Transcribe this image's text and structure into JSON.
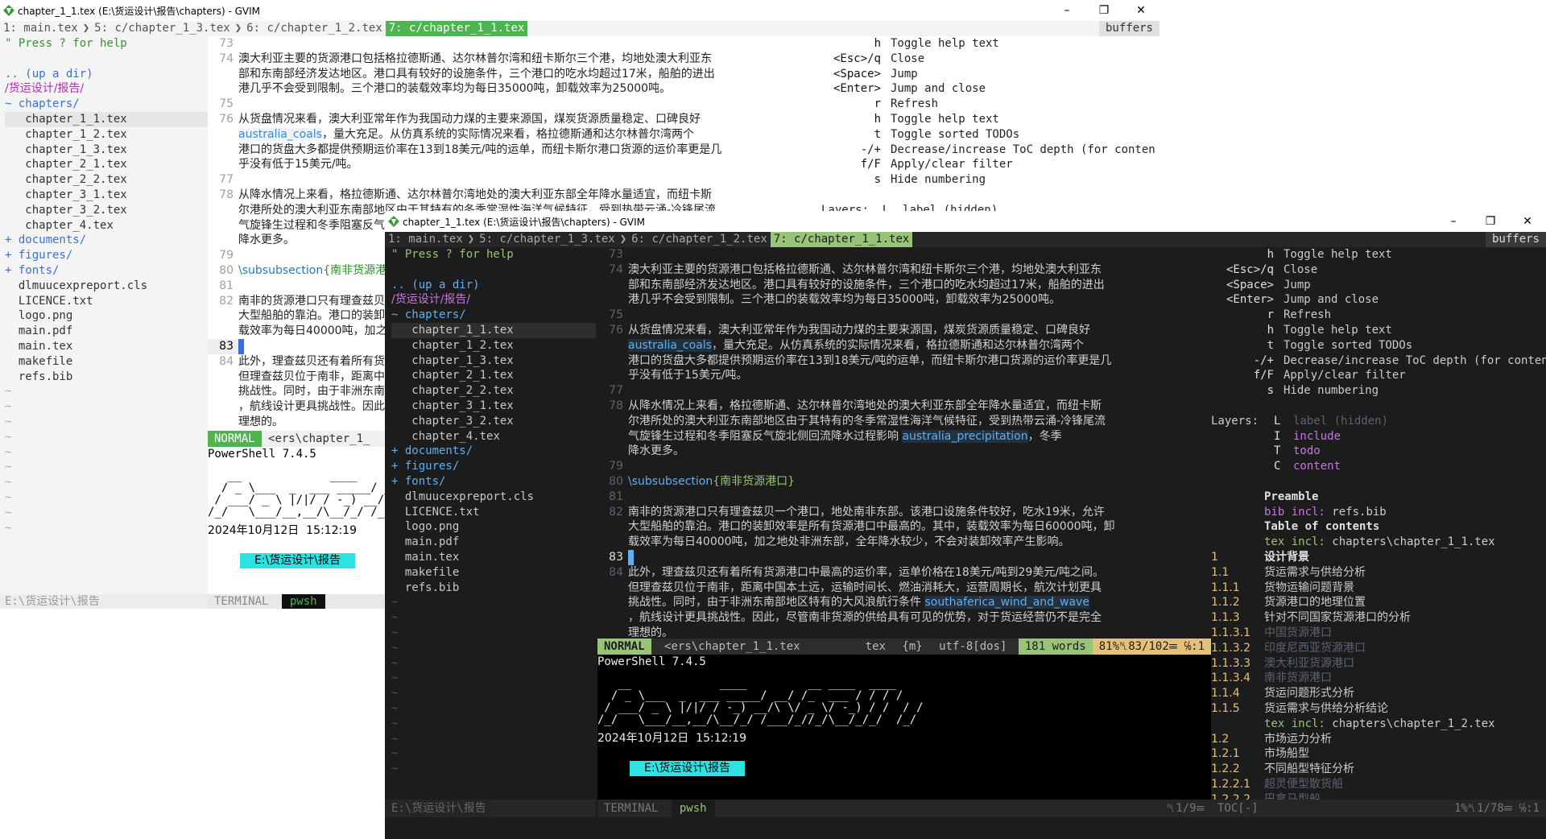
{
  "windows": {
    "back": {
      "title": "chapter_1_1.tex (E:\\货运设计\\报告\\chapters) - GVIM",
      "tabs": [
        "1: main.tex",
        "5: c/chapter_1_3.tex",
        "6: c/chapter_1_2.tex",
        "7: c/chapter_1_1.tex"
      ],
      "buffers_label": "buffers",
      "statusline": {
        "mode": "NORMAL",
        "file": "<ers\\chapter_1_"
      },
      "tree_status": "E:\\货运设计\\报告",
      "terminal_status": {
        "label": "TERMINAL",
        "shell": "pwsh"
      },
      "help_layers": "Layers:  L  label (hidden)"
    },
    "front": {
      "title": "chapter_1_1.tex (E:\\货运设计\\报告\\chapters) - GVIM",
      "tabs": [
        "1: main.tex",
        "5: c/chapter_1_3.tex",
        "6: c/chapter_1_2.tex",
        "7: c/chapter_1_1.tex"
      ],
      "buffers_label": "buffers",
      "statusline": {
        "mode": "NORMAL",
        "file": "<ers\\chapter_1_1.tex",
        "filetype": "tex",
        "extra": "{m}",
        "encoding": "utf-8[dos]",
        "words": "181 words",
        "position": "81%␤83/102☰ ℅:1"
      },
      "tree_status": "E:\\货运设计\\报告",
      "tree_status_right": "␤1/9☰",
      "terminal_status": {
        "label": "TERMINAL",
        "shell": "pwsh"
      },
      "toc_status": "TOC[-]",
      "toc_status_right": "1%␤1/78☰ ℅:1"
    }
  },
  "tree": {
    "help": "\" Press ? for help",
    "up": ".. (up a dir)",
    "path": "/货运设计/报告/",
    "chapters_dir": "~ chapters/",
    "chapter_files": [
      "chapter_1_1.tex",
      "chapter_1_2.tex",
      "chapter_1_3.tex",
      "chapter_2_1.tex",
      "chapter_2_2.tex",
      "chapter_3_1.tex",
      "chapter_3_2.tex",
      "chapter_4.tex"
    ],
    "collapsed_dirs": [
      "+ documents/",
      "+ figures/",
      "+ fonts/"
    ],
    "files": [
      "dlmuucexpreport.cls",
      "LICENCE.txt",
      "logo.png",
      "main.pdf",
      "main.tex",
      "makefile",
      "refs.bib"
    ]
  },
  "editor": {
    "lines": [
      {
        "n": "73",
        "t": ""
      },
      {
        "n": "74",
        "t": "澳大利亚主要的货源港口包括格拉德斯通、达尔林普尔湾和纽卡斯尔三个港，均地处澳大利亚东"
      },
      {
        "n": "",
        "t": "部和东南部经济发达地区。港口具有较好的设施条件，三个港口的吃水均超过17米，船舶的进出"
      },
      {
        "n": "",
        "t": "港几乎不会受到限制。三个港口的装载效率均为每日35000吨，卸载效率为25000吨。"
      },
      {
        "n": "75",
        "t": ""
      },
      {
        "n": "76",
        "t": "从货盘情况来看，澳大利亚常年作为我国动力煤的主要来源国，煤炭货源质量稳定、口碑良好"
      },
      {
        "n": "",
        "t": "",
        "ref": "australia_coals",
        "after": "，量大充足。从仿真系统的实际情况来看，格拉德斯通和达尔林普尔湾两个"
      },
      {
        "n": "",
        "t": "港口的货盘大多都提供预期运价率在13到18美元/吨的运单，而纽卡斯尔港口货源的运价率更是几"
      },
      {
        "n": "",
        "t": "乎没有低于15美元/吨。"
      },
      {
        "n": "77",
        "t": ""
      },
      {
        "n": "78",
        "t": "从降水情况上来看，格拉德斯通、达尔林普尔湾地处的澳大利亚东部全年降水量适宜，而纽卡斯"
      },
      {
        "n": "",
        "t": "尔港所处的澳大利亚东南部地区由于其特有的冬季常湿性海洋气候特征，受到热带云涌-冷锋尾流"
      },
      {
        "n": "",
        "t": "气旋锋生过程和冬季阻塞反气旋北侧回流降水过程影响 ",
        "ref": "australia_precipitation",
        "after": "，冬季"
      },
      {
        "n": "",
        "t": "降水更多。"
      },
      {
        "n": "79",
        "t": ""
      },
      {
        "n": "80",
        "t": "",
        "kw": "\\subsubsection",
        "arg": "{南非货源港口}"
      },
      {
        "n": "81",
        "t": ""
      },
      {
        "n": "82",
        "t": "南非的货源港口只有理查兹贝一个港口，地处南非东部。该港口设施条件较好，吃水19米，允许"
      },
      {
        "n": "",
        "t": "大型船舶的靠泊。港口的装卸效率是所有货源港口中最高的。其中，装载效率为每日60000吨，卸"
      },
      {
        "n": "",
        "t": "载效率为每日40000吨，加之地处非洲东部，全年降水较少，不会对装卸效率产生影响。"
      },
      {
        "n": "83",
        "t": "",
        "cursor": true
      },
      {
        "n": "84",
        "t": "此外，理查兹贝还有着所有货源港口中最高的运价率，运单价格在18美元/吨到29美元/吨之间。"
      },
      {
        "n": "",
        "t": "但理查兹贝位于南非，距离中国本土远，运输时间长、燃油消耗大，运营周期长，航次计划更具"
      },
      {
        "n": "",
        "t": "挑战性。同时，由于非洲东南部地区特有的大风浪航行条件 ",
        "ref": "southaferica_wind_and_wave"
      },
      {
        "n": "",
        "t": "，航线设计更具挑战性。因此，尽管南非货源的供给具有可见的优势，对于货运经营仍不是完全"
      },
      {
        "n": "",
        "t": "理想的。"
      }
    ]
  },
  "help": {
    "keys": [
      {
        "k": "h",
        "d": "Toggle help text"
      },
      {
        "k": "<Esc>/q",
        "d": "Close"
      },
      {
        "k": "<Space>",
        "d": "Jump"
      },
      {
        "k": "<Enter>",
        "d": "Jump and close"
      },
      {
        "k": "r",
        "d": "Refresh"
      },
      {
        "k": "h",
        "d": "Toggle help text"
      },
      {
        "k": "t",
        "d": "Toggle sorted TODOs"
      },
      {
        "k": "-/+",
        "d": "Decrease/increase ToC depth (for conten"
      },
      {
        "k": "f/F",
        "d": "Apply/clear filter"
      },
      {
        "k": "s",
        "d": "Hide numbering"
      }
    ],
    "layers_label": "Layers:",
    "layers": [
      {
        "k": "L",
        "d": "label (hidden)",
        "dim": true
      },
      {
        "k": "I",
        "d": "include"
      },
      {
        "k": "T",
        "d": "todo"
      },
      {
        "k": "C",
        "d": "content"
      }
    ],
    "preamble_label": "Preamble",
    "bib_incl": "bib incl:",
    "bib_file": "refs.bib",
    "toc_label": "Table of contents",
    "tex_incl": "tex incl:",
    "toc": [
      {
        "type": "incl",
        "v": "chapters\\chapter_1_1.tex"
      },
      {
        "n": "1",
        "t": "设计背景",
        "bold": true
      },
      {
        "n": "1.1",
        "t": "货运需求与供给分析"
      },
      {
        "n": "1.1.1",
        "t": "货物运输问题背景"
      },
      {
        "n": "1.1.2",
        "t": "货源港口的地理位置"
      },
      {
        "n": "1.1.3",
        "t": "针对不同国家货源港口的分析"
      },
      {
        "n": "1.1.3.1",
        "t": "中国货源港口",
        "dim": true
      },
      {
        "n": "1.1.3.2",
        "t": "印度尼西亚货源港口",
        "dim": true
      },
      {
        "n": "1.1.3.3",
        "t": "澳大利亚货源港口",
        "dim": true
      },
      {
        "n": "1.1.3.4",
        "t": "南非货源港口",
        "dim": true
      },
      {
        "n": "1.1.4",
        "t": "货运问题形式分析"
      },
      {
        "n": "1.1.5",
        "t": "货运需求与供给分析结论"
      },
      {
        "type": "incl",
        "v": "chapters\\chapter_1_2.tex"
      },
      {
        "n": "1.2",
        "t": "市场运力分析"
      },
      {
        "n": "1.2.1",
        "t": "市场船型"
      },
      {
        "n": "1.2.2",
        "t": "不同船型特征分析"
      },
      {
        "n": "1.2.2.1",
        "t": "超灵便型散货船",
        "dim": true
      },
      {
        "n": "1.2.2.2",
        "t": "巴拿马型船",
        "dim": true
      }
    ]
  },
  "terminal": {
    "header": "PowerShell 7.4.5",
    "ascii": "   __             ____         __ ____  ____\n  / _ \\___  _  ___ _____/ __/ /_  ___ / / / /\n / ___/ _ \\ |/|/ / -_) __/\\ \\/ _ \\/ -_) / /  / /\n/_/   \\___/__,__/\\__/_/ /___/_//_/\\__/_/_/  /_/",
    "datetime": "2024年10月12日  15:12:19",
    "cwd": "E:\\货运设计\\报告"
  }
}
